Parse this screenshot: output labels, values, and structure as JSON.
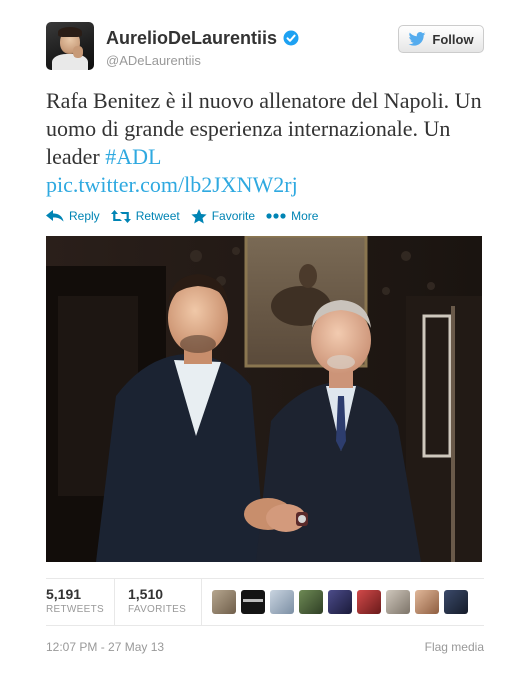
{
  "header": {
    "display_name": "AurelioDeLaurentiis",
    "handle": "@ADeLaurentiis",
    "follow_label": "Follow"
  },
  "tweet": {
    "text_main": "Rafa Benitez è il nuovo allenatore del Napoli. Un uomo di grande esperienza internazionale. Un leader ",
    "hashtag": "#ADL",
    "link": "pic.twitter.com/lb2JXNW2rj"
  },
  "actions": {
    "reply": "Reply",
    "retweet": "Retweet",
    "favorite": "Favorite",
    "more": "More"
  },
  "stats": {
    "retweets_count": "5,191",
    "retweets_label": "RETWEETS",
    "favorites_count": "1,510",
    "favorites_label": "FAVORITES",
    "favoriter_avatar_count": 9
  },
  "footer": {
    "timestamp": "12:07 PM - 27 May 13",
    "flag": "Flag media"
  },
  "colors": {
    "link": "#2fa9e0",
    "action": "#0084b4",
    "verified": "#1da1f2",
    "twitter_bird": "#55acee"
  },
  "icons": {
    "verified": "verified-badge-icon",
    "follow": "twitter-bird-icon",
    "reply": "reply-arrow-icon",
    "retweet": "retweet-icon",
    "favorite": "star-icon",
    "more": "ellipsis-icon"
  }
}
